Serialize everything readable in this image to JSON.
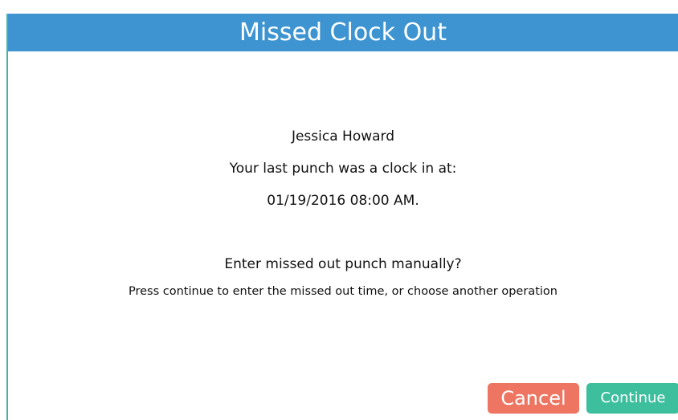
{
  "dialog": {
    "title": "Missed Clock Out",
    "employee_name": "Jessica Howard",
    "last_punch_label": "Your last punch was a clock in at:",
    "last_punch_time": "01/19/2016 08:00 AM.",
    "question": "Enter missed out punch manually?",
    "hint": "Press continue to enter the missed out time, or choose another operation",
    "buttons": {
      "cancel_label": "Cancel",
      "continue_label": "Continue"
    }
  },
  "colors": {
    "title_bar": "#3d94d1",
    "cancel_button": "#ee7561",
    "continue_button": "#3dbf9e",
    "border_accent": "#4ab3a4"
  }
}
